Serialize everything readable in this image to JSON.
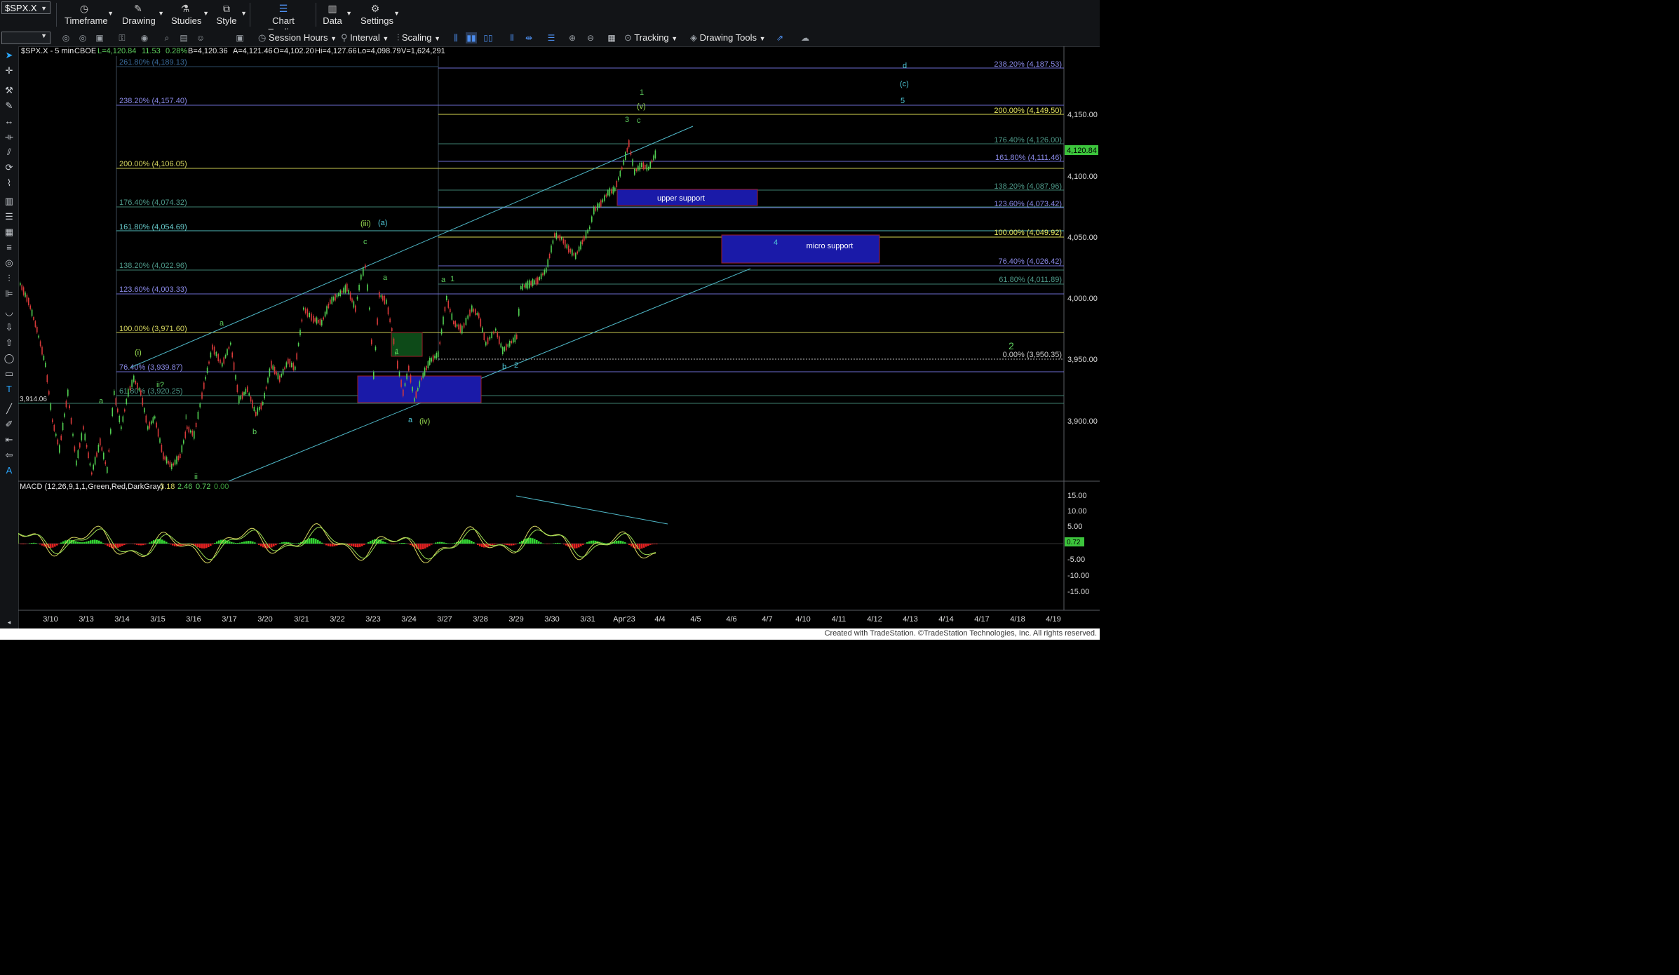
{
  "toolbar": {
    "symbol": "$SPX.X",
    "items": [
      {
        "label": "Timeframe",
        "icon": "clock-icon"
      },
      {
        "label": "Drawing",
        "icon": "pen-icon"
      },
      {
        "label": "Studies",
        "icon": "flask-icon"
      },
      {
        "label": "Style",
        "icon": "style-icon"
      },
      {
        "label": "Chart Trading",
        "icon": "chart-trading-icon"
      },
      {
        "label": "Data",
        "icon": "data-icon"
      },
      {
        "label": "Settings",
        "icon": "gear-icon"
      }
    ]
  },
  "toolbar2": {
    "session_hours": "Session Hours",
    "interval": "Interval",
    "scaling": "Scaling",
    "tracking": "Tracking",
    "drawing_tools": "Drawing Tools"
  },
  "chart": {
    "header": {
      "symbol_interval": "$SPX.X - 5 min",
      "exchange": "CBOE",
      "last": "L=4,120.84",
      "change": "11.53",
      "pct": "0.28%",
      "bid": "B=4,120.36",
      "ask": "A=4,121.46",
      "open": "O=4,102.20",
      "high": "Hi=4,127.66",
      "low": "Lo=4,098.79",
      "volume": "V=1,624,291"
    },
    "price_axis": [
      "4,150.00",
      "4,100.00",
      "4,050.00",
      "4,000.00",
      "3,950.00",
      "3,900.00"
    ],
    "last_price_tag": "4,120.84",
    "date_axis": [
      "3/10",
      "3/13",
      "3/14",
      "3/15",
      "3/16",
      "3/17",
      "3/20",
      "3/21",
      "3/22",
      "3/23",
      "3/24",
      "3/27",
      "3/28",
      "3/29",
      "3/30",
      "3/31",
      "Apr'23",
      "4/4",
      "4/5",
      "4/6",
      "4/7",
      "4/10",
      "4/11",
      "4/12",
      "4/13",
      "4/14",
      "4/17",
      "4/18",
      "4/19"
    ],
    "left_fibs": [
      {
        "label": "261.80% (4,189.13)",
        "color": "#3a6b9a"
      },
      {
        "label": "238.20% (4,157.40)",
        "color": "#8a8ae8"
      },
      {
        "label": "200.00% (4,106.05)",
        "color": "#d8d860"
      },
      {
        "label": "176.40% (4,074.32)",
        "color": "#4e9a8a"
      },
      {
        "label": "161.80% (4,054.69)",
        "color": "#6ad0d0"
      },
      {
        "label": "138.20% (4,022.96)",
        "color": "#4e9a8a"
      },
      {
        "label": "123.60% (4,003.33)",
        "color": "#8a8ae8"
      },
      {
        "label": "100.00% (3,971.60)",
        "color": "#d8d860"
      },
      {
        "label": "76.40% (3,939.87)",
        "color": "#8a8ae8"
      },
      {
        "label": "61.80% (3,920.25)",
        "color": "#4e9a8a"
      }
    ],
    "right_fibs": [
      {
        "label": "238.20% (4,187.53)",
        "color": "#8a8ae8"
      },
      {
        "label": "200.00% (4,149.50)",
        "color": "#e8e860"
      },
      {
        "label": "176.40% (4,126.00)",
        "color": "#4e9a8a"
      },
      {
        "label": "161.80% (4,111.46)",
        "color": "#8a8ae8"
      },
      {
        "label": "138.20% (4,087.96)",
        "color": "#4e9a8a"
      },
      {
        "label": "123.60% (4,073.42)",
        "color": "#8a8ae8"
      },
      {
        "label": "100.00% (4,049.92)",
        "color": "#e8e860"
      },
      {
        "label": "76.40% (4,026.42)",
        "color": "#8a8ae8"
      },
      {
        "label": "61.80% (4,011.89)",
        "color": "#4e9a8a"
      },
      {
        "label": "0.00% (3,950.35)",
        "color": "#cccccc"
      }
    ],
    "level_tag": "3,914.06",
    "zones": {
      "upper": "upper support",
      "micro": "micro support"
    },
    "wave_labels": {
      "w1": "1",
      "wv": "(v)",
      "wc": "c",
      "w3": "3",
      "wd": "d",
      "wC": "(c)",
      "w5": "5",
      "w4": "4",
      "w2": "2",
      "wiii": "(iii)",
      "wa_paren": "(a)",
      "wc2": "c",
      "wa2": "a",
      "wa3": "a",
      "w1b": "1",
      "wi": "(i)",
      "wii": "ii?",
      "wa4": "a",
      "wa5": "a",
      "wb": "b",
      "wb2": "b",
      "w2b": "2",
      "wa6": "a",
      "wiv": "(iv)",
      "wi2": "i",
      "wii2": "ii",
      "w1c": "1"
    }
  },
  "macd": {
    "label": "MACD (12,26,9,1,1,Green,Red,DarkGray)",
    "v1": "3.18",
    "v2": "2.46",
    "v3": "0.72",
    "v4": "0.00",
    "axis": [
      "15.00",
      "10.00",
      "5.00",
      "-5.00",
      "-10.00",
      "-15.00"
    ],
    "tag": "0.72"
  },
  "footer": "Created with TradeStation. ©TradeStation Technologies, Inc. All rights reserved."
}
